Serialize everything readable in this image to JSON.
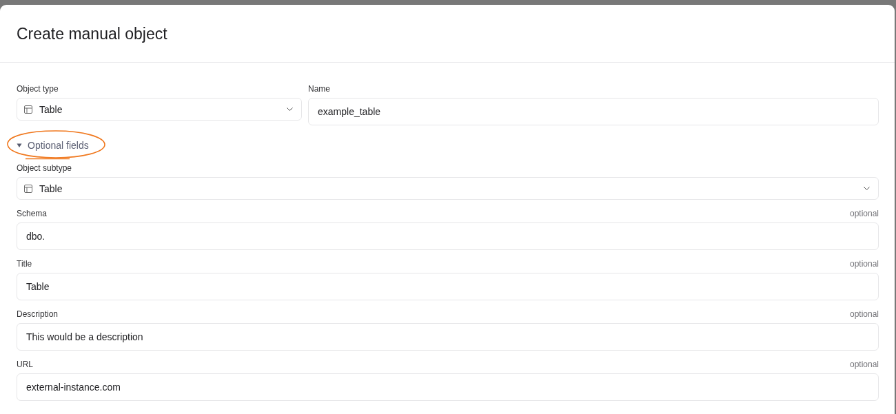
{
  "dialog": {
    "title": "Create manual object"
  },
  "top_fields": [
    {
      "kind": "select",
      "label": "Object type",
      "value": "Table"
    },
    {
      "kind": "input",
      "label": "Name",
      "value": "example_table"
    }
  ],
  "optional_section": {
    "label": "Optional fields",
    "expanded": true,
    "highlighted": true
  },
  "optional_fields": [
    {
      "kind": "select",
      "label": "Object subtype",
      "value": "Table"
    },
    {
      "kind": "input",
      "label": "Schema",
      "note": "optional",
      "value": "dbo."
    },
    {
      "kind": "input",
      "label": "Title",
      "note": "optional",
      "value": "Table"
    },
    {
      "kind": "input",
      "label": "Description",
      "note": "optional",
      "value": "This would be a description"
    },
    {
      "kind": "input",
      "label": "URL",
      "note": "optional",
      "value": "external-instance.com"
    }
  ]
}
